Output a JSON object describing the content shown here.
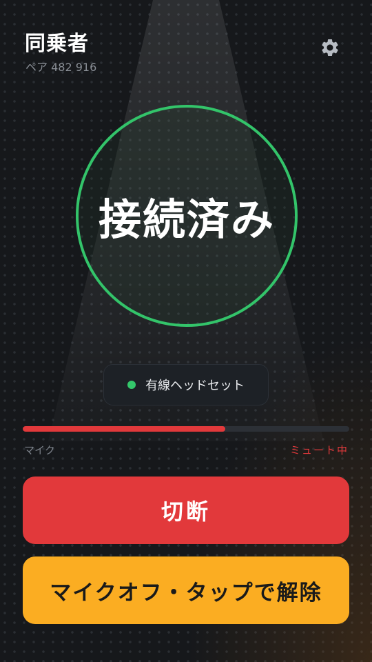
{
  "header": {
    "title": "同乗者",
    "pair_code": "ペア 482 916",
    "settings_icon": "gear-icon"
  },
  "status": {
    "label": "接続済み",
    "ring_color": "#33c46a"
  },
  "audio_device": {
    "label": "有線ヘッドセット",
    "indicator_color": "#34c76b"
  },
  "mic": {
    "label": "マイク",
    "state_label": "ミュート中",
    "level": 0.62,
    "level_color": "#e2393b"
  },
  "actions": {
    "disconnect_label": "切断",
    "unmute_label": "マイクオフ・タップで解除"
  },
  "colors": {
    "background": "#16181b",
    "danger": "#e2393b",
    "warning": "#fbad22"
  }
}
